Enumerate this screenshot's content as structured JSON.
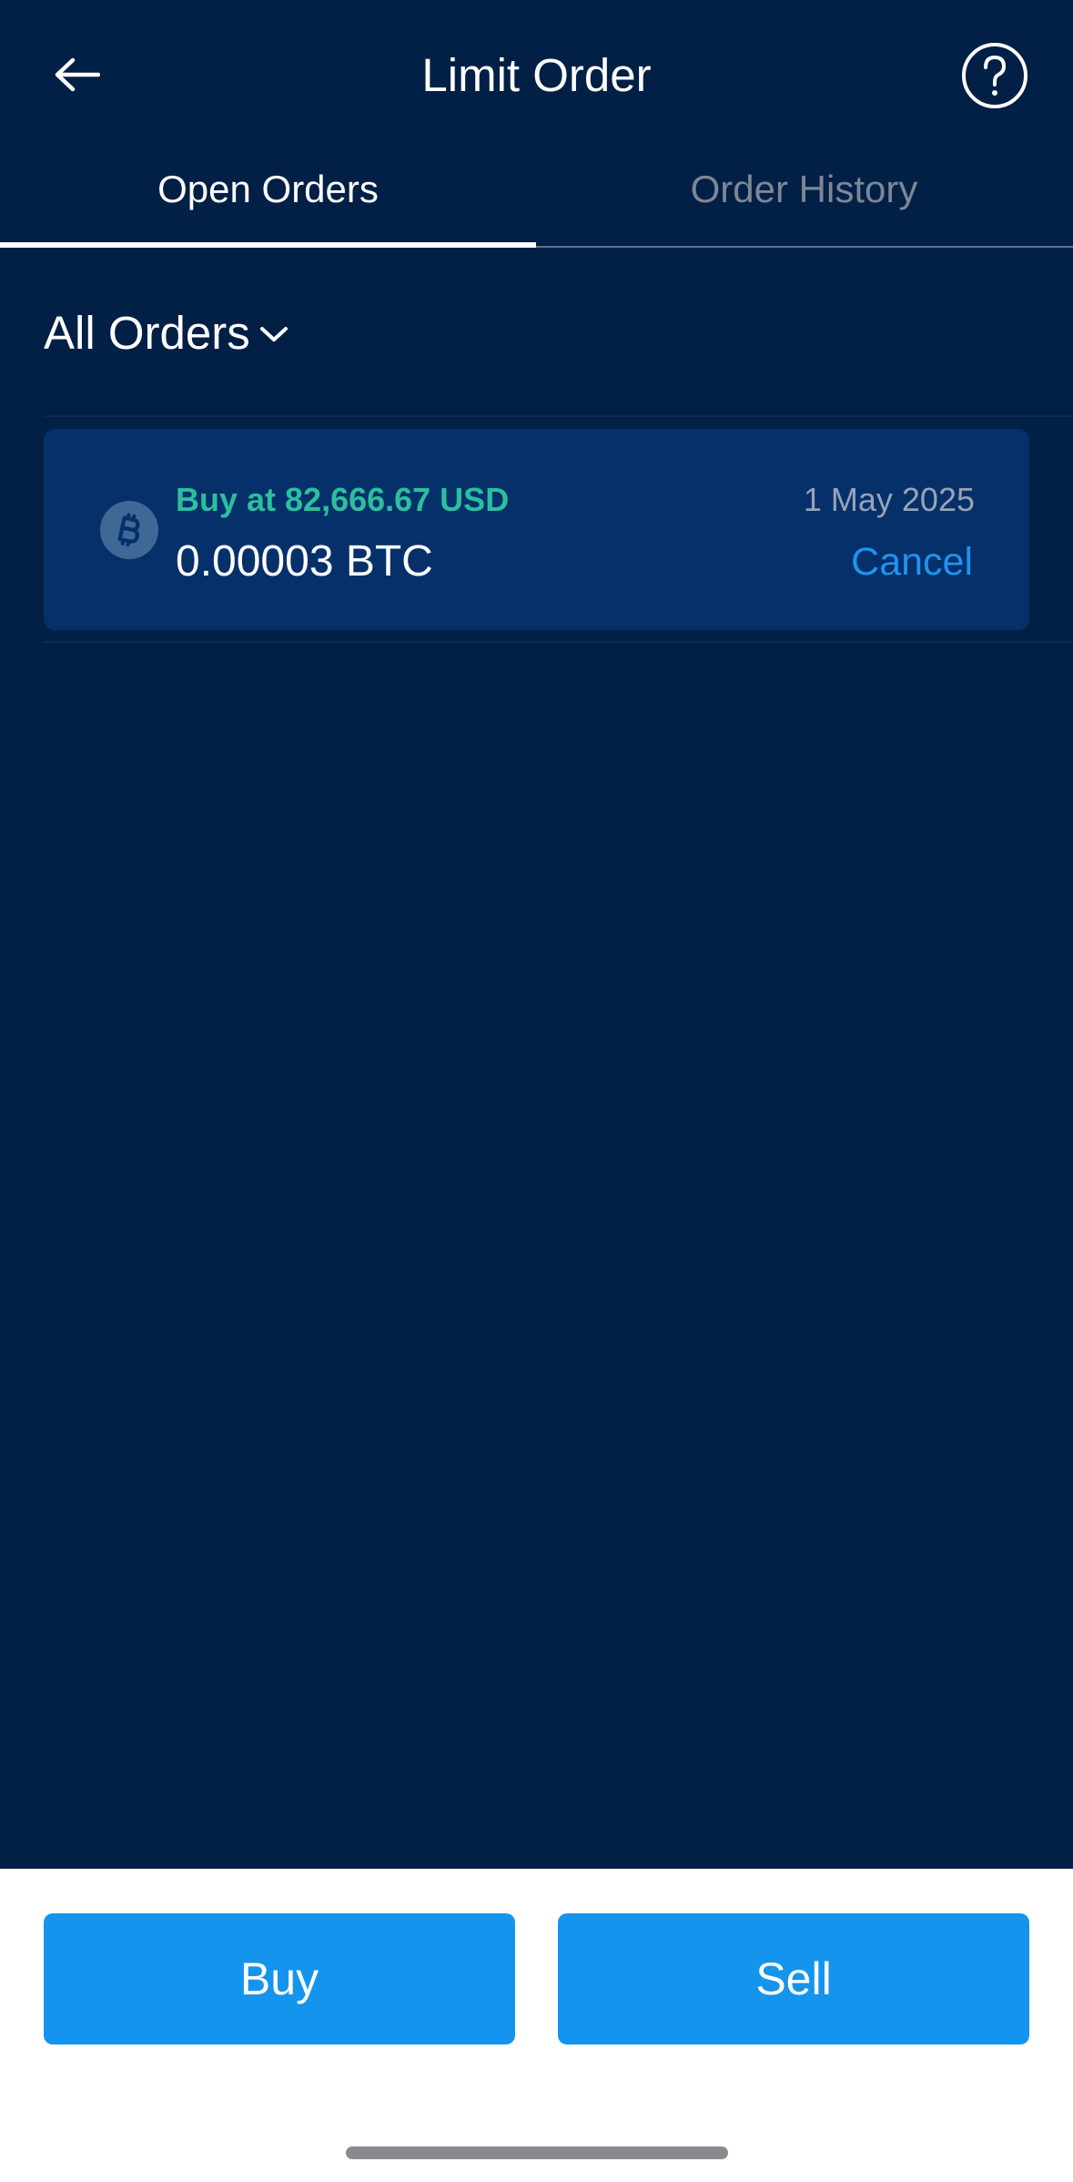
{
  "header": {
    "title": "Limit Order",
    "back_icon": "arrow-left-icon",
    "help_icon": "question-circle-icon"
  },
  "tabs": [
    {
      "label": "Open Orders",
      "active": true
    },
    {
      "label": "Order History",
      "active": false
    }
  ],
  "filter": {
    "label": "All Orders",
    "icon": "chevron-down-icon"
  },
  "orders": [
    {
      "coin_icon": "bitcoin-icon",
      "price_line": "Buy at 82,666.67 USD",
      "amount": "0.00003 BTC",
      "date": "1 May 2025",
      "cancel_label": "Cancel"
    }
  ],
  "actions": {
    "buy_label": "Buy",
    "sell_label": "Sell"
  },
  "colors": {
    "background": "#021f45",
    "card": "#05306a",
    "buy_price": "#2bbf9f",
    "link": "#1f93ef",
    "button": "#1594ee"
  }
}
